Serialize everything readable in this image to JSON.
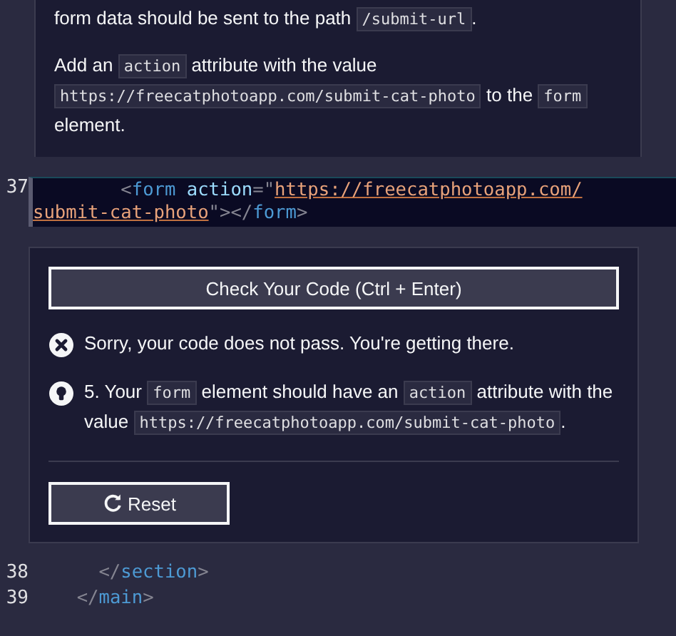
{
  "instructions": [
    [
      {
        "kind": "text",
        "text": "form data should be sent to the path "
      },
      {
        "kind": "code",
        "text": "/submit-url"
      },
      {
        "kind": "text",
        "text": "."
      }
    ],
    [
      {
        "kind": "text",
        "text": "Add an "
      },
      {
        "kind": "code",
        "text": "action"
      },
      {
        "kind": "text",
        "text": " attribute with the value "
      },
      {
        "kind": "code",
        "text": "https://freecatphotoapp.com/submit-cat-photo"
      },
      {
        "kind": "text",
        "text": " to the "
      },
      {
        "kind": "code",
        "text": "form"
      },
      {
        "kind": "text",
        "text": " element."
      }
    ]
  ],
  "editor_line": {
    "number": "37",
    "tokens": [
      {
        "kind": "punct",
        "text": "        <"
      },
      {
        "kind": "tag",
        "text": "form"
      },
      {
        "kind": "attr",
        "text": " action"
      },
      {
        "kind": "punct",
        "text": "=\""
      },
      {
        "kind": "string",
        "text": "https://freecatphotoapp.com/submit-cat-photo"
      },
      {
        "kind": "punct",
        "text": "\"></"
      },
      {
        "kind": "tag",
        "text": "form"
      },
      {
        "kind": "punct",
        "text": ">"
      }
    ]
  },
  "feedback": {
    "check_button": "Check Your Code (Ctrl + Enter)",
    "messages": [
      {
        "kind": "error",
        "parts": [
          {
            "kind": "text",
            "text": "Sorry, your code does not pass. You're getting there."
          }
        ]
      },
      {
        "kind": "hint",
        "parts": [
          {
            "kind": "text",
            "text": "5. Your "
          },
          {
            "kind": "code",
            "text": "form"
          },
          {
            "kind": "text",
            "text": " element should have an "
          },
          {
            "kind": "code",
            "text": "action"
          },
          {
            "kind": "text",
            "text": " attribute with the value "
          },
          {
            "kind": "code",
            "text": "https://freecatphotoapp.com/submit-cat-photo"
          },
          {
            "kind": "text",
            "text": "."
          }
        ]
      }
    ],
    "reset_button": "Reset"
  },
  "editor_lines_after": [
    {
      "number": "38",
      "tokens": [
        {
          "kind": "punct",
          "text": "      </"
        },
        {
          "kind": "tag",
          "text": "section"
        },
        {
          "kind": "punct",
          "text": ">"
        }
      ]
    },
    {
      "number": "39",
      "tokens": [
        {
          "kind": "punct",
          "text": "    </"
        },
        {
          "kind": "tag",
          "text": "main"
        },
        {
          "kind": "punct",
          "text": ">"
        }
      ]
    }
  ]
}
